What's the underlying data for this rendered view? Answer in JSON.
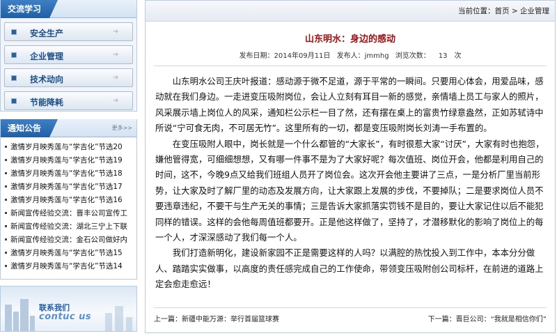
{
  "sidebar": {
    "category_title": "交流学习",
    "categories": [
      {
        "label": "安全生产"
      },
      {
        "label": "企业管理"
      },
      {
        "label": "技术动向"
      },
      {
        "label": "节能降耗"
      }
    ],
    "notice_title": "通知公告",
    "notice_more": "更多>>",
    "notices": [
      "激情岁月映秀莲与“学吉化”节选20",
      "激情岁月映秀莲与“学吉化”节选19",
      "激情岁月映秀莲与“学吉化”节选18",
      "激情岁月映秀莲与“学吉化”节选17",
      "激情岁月映秀莲与“学吉化”节选16",
      "新闻宣传经验交流：晋丰公司宣传工",
      "新闻宣传经验交流：湖北三宁上下联",
      "新闻宣传经验交流：金石公司做好内",
      "激情岁月映秀莲与“学吉化”节选15",
      "激情岁月映秀莲与“学吉化”节选14"
    ],
    "contact_cn": "联系我们",
    "contact_en": "contuc us"
  },
  "breadcrumb": {
    "prefix": "当前位置：",
    "home": "首页",
    "sep": " > ",
    "current": "企业管理"
  },
  "article": {
    "title": "山东明水：身边的感动",
    "date_label": "发布日期：",
    "date": "2014年09月11日",
    "publisher_label": "发布人：",
    "publisher": "jmmhg",
    "views_label": "浏览次数：",
    "views": "13",
    "views_unit": "次",
    "paragraphs": [
      "山东明水公司王庆叶报道：感动源于微不足道，源于平常的一瞬间。只要用心体会，用爱品味，感动就在我们身边。一走进变压吸附岗位，会让人立刻有耳目一新的感觉，亲情墙上员工与家人的照片，风采展示墙上岗位人的风采，通知栏公示栏一目了然，还有摆在桌上的富贵竹绿意盎然，正如苏轼诗中所说“宁可食无肉，不可居无竹”。这里所有的一切，都是变压吸附岗长刘涛一手布置的。",
      "在变压吸附人眼中，岗长就是一个什么都管的“大家长”，有时很惹大家“讨厌”，大家有时也抱怨，嫌他管得宽，可细细想想，又有哪一件事不是为了大家好呢？每次值班、岗位开会，他都是利用自己的时间，这不，今晚9点又给我们班组人员开了岗位会。这次开会他主要讲了三点，一是分析厂里当前形势，让大家及时了解厂里的动态及发展方向，让大家跟上发展的步伐，不要掉队；二是要求岗位人员不要违章违纪，不要干与生产无关的事情；三是告诉大家抓落实罚钱不是目的，要让大家记住以后不能犯同样的错误。这样的会他每周值班都要开。正是他这样做了，坚持了，才潜移默化的影响了岗位上的每一个人，才深深感动了我们每一个人。",
      "我们打造新明化，建设新家园不正是需要这样的人吗？以满腔的热忱投入到工作中，本本分分做人、踏踏实实做事，以高度的责任感完成自己的工作使命，带领变压吸附创公司标杆，在前进的道路上定会愈走愈远！"
    ]
  },
  "pager": {
    "prev_label": "上一篇：",
    "prev_title": "新疆中能万源：举行首届篮球赛",
    "next_label": "下一篇：",
    "next_title": "晋巨公司：“我就是相信你们”"
  }
}
